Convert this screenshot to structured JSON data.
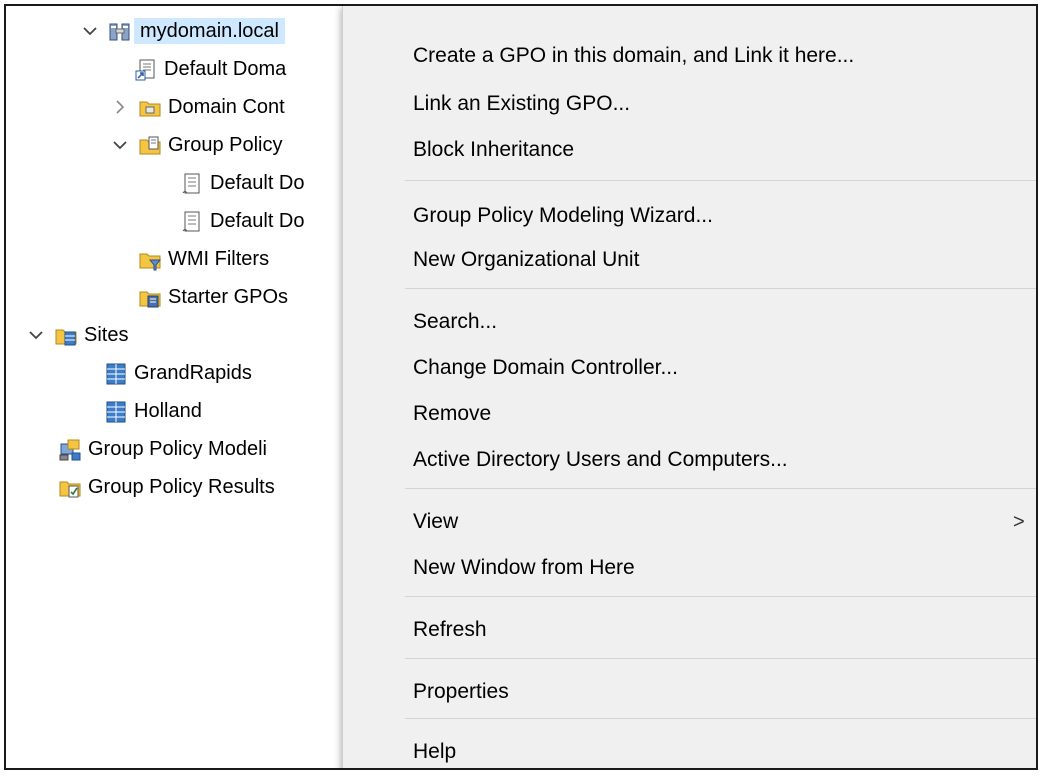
{
  "tree": {
    "root": {
      "label": "mydomain.local",
      "icon": "domain-icon"
    },
    "items": [
      {
        "label": "Default Doma",
        "icon": "gpo-link-icon"
      },
      {
        "label": "Domain Cont",
        "icon": "ou-folder-icon"
      },
      {
        "label": "Group Policy",
        "icon": "gpo-folder-icon"
      },
      {
        "label": "Default Do",
        "icon": "gpo-scroll-icon"
      },
      {
        "label": "Default Do",
        "icon": "gpo-scroll-icon"
      },
      {
        "label": "WMI Filters",
        "icon": "wmi-filter-folder-icon"
      },
      {
        "label": "Starter GPOs",
        "icon": "starter-gpo-folder-icon"
      },
      {
        "label": "Sites",
        "icon": "sites-folder-icon"
      },
      {
        "label": "GrandRapids",
        "icon": "site-icon"
      },
      {
        "label": "Holland",
        "icon": "site-icon"
      },
      {
        "label": "Group Policy Modeli",
        "icon": "modeling-icon"
      },
      {
        "label": "Group Policy Results",
        "icon": "results-icon"
      }
    ]
  },
  "context_menu": {
    "items": [
      "Create a GPO in this domain, and Link it here...",
      "Link an Existing GPO...",
      "Block Inheritance",
      "Group Policy Modeling Wizard...",
      "New Organizational Unit",
      "Search...",
      "Change Domain Controller...",
      "Remove",
      "Active Directory Users and Computers...",
      "View",
      "New Window from Here",
      "Refresh",
      "Properties",
      "Help"
    ],
    "submenu_arrow": ">"
  },
  "colors": {
    "menu_bg": "#f0f0f0",
    "selection": "#cde8ff",
    "separator": "#d4d4d4",
    "folder": "#f4c542"
  }
}
